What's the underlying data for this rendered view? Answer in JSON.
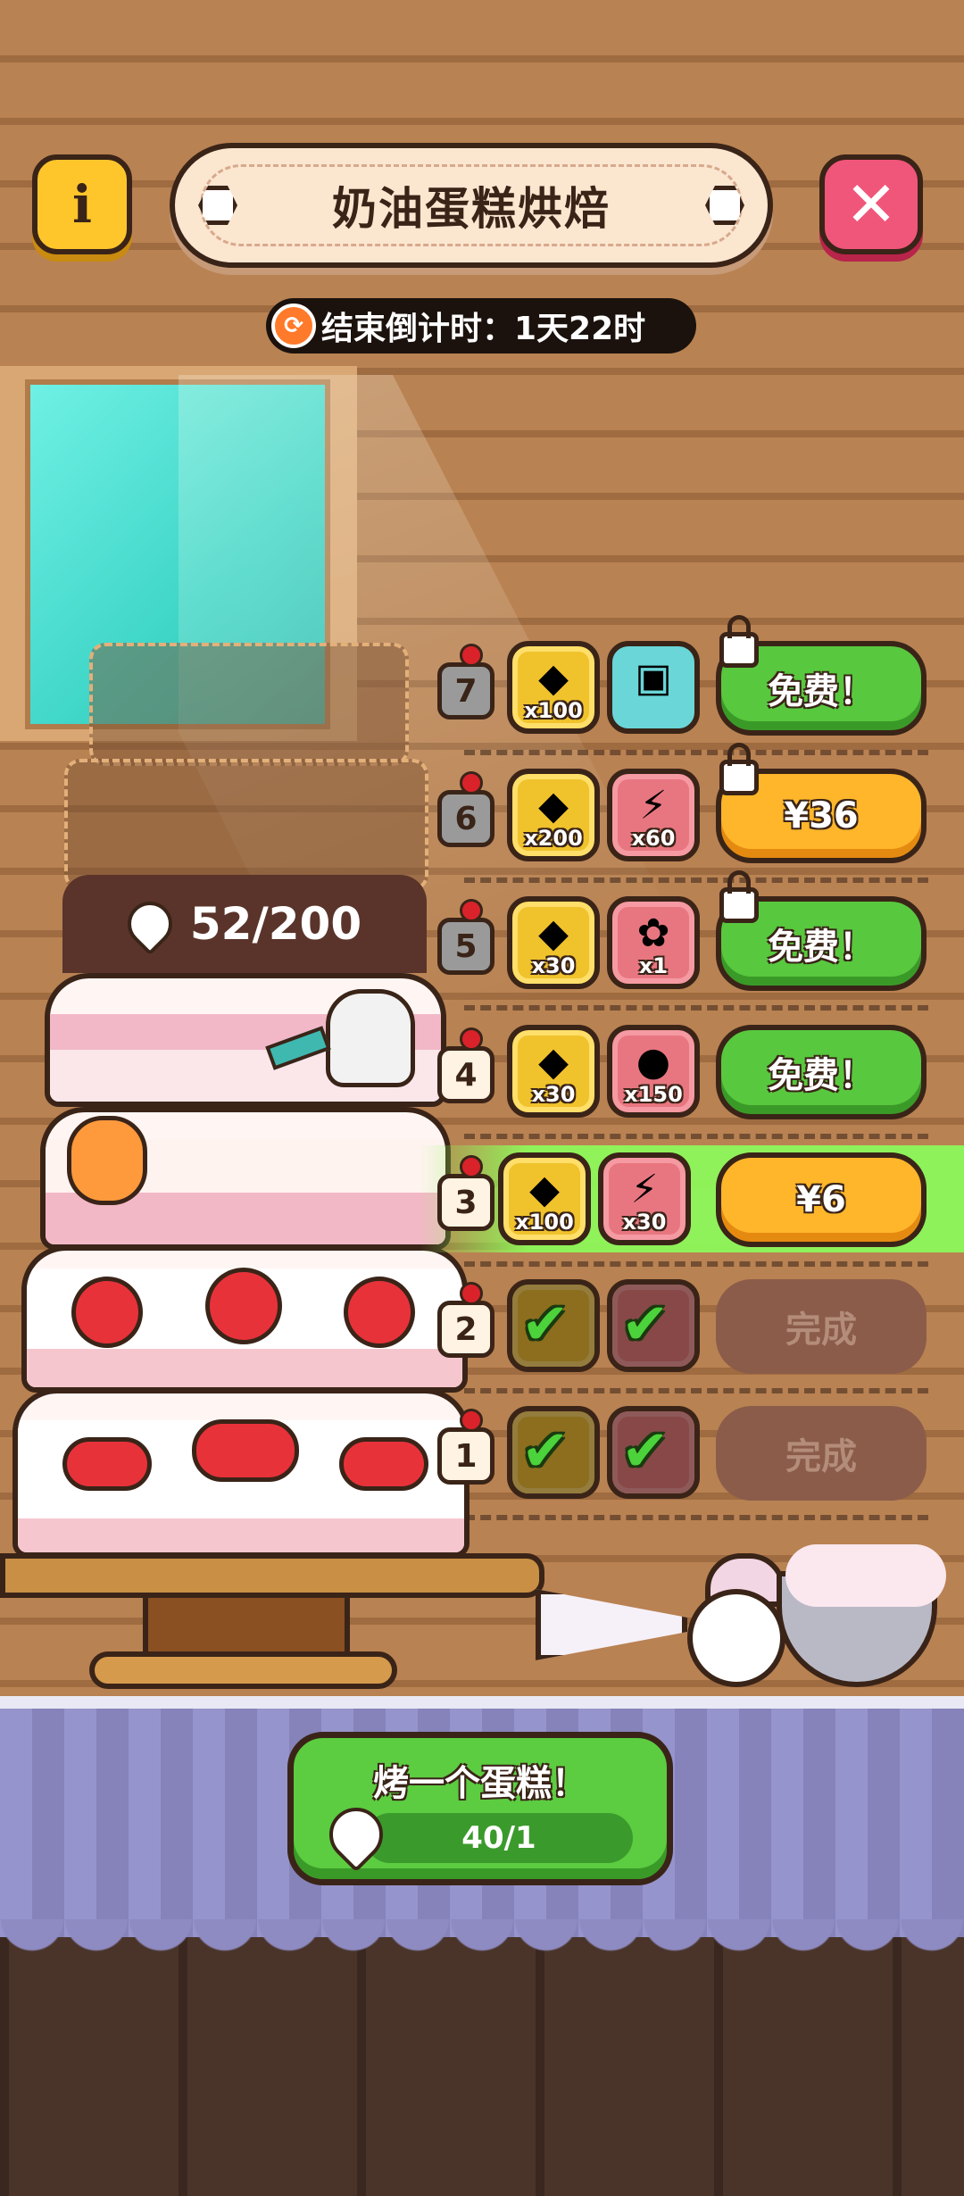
{
  "header": {
    "title": "奶油蛋糕烘焙",
    "info_icon": "info-icon",
    "close_icon": "close-icon",
    "countdown_label": "结束倒计时：1天22时"
  },
  "cake_progress": {
    "current_text": "52/200",
    "current": 52,
    "total": 200
  },
  "reward_tiers": [
    {
      "level": "7",
      "reward1_qty": "x100",
      "reward1_icon": "crystal-icon",
      "reward2_qty": "",
      "reward2_icon": "robot-card-icon",
      "button": "免费！",
      "button_style": "green",
      "locked": true
    },
    {
      "level": "6",
      "reward1_qty": "x200",
      "reward1_icon": "crystal-icon",
      "reward2_qty": "x60",
      "reward2_icon": "lightning-icon",
      "button": "¥36",
      "button_style": "orange",
      "locked": true
    },
    {
      "level": "5",
      "reward1_qty": "x30",
      "reward1_icon": "crystal-icon",
      "reward2_qty": "x1",
      "reward2_icon": "seed-packet-icon",
      "button": "免费！",
      "button_style": "green",
      "locked": true
    },
    {
      "level": "4",
      "reward1_qty": "x30",
      "reward1_icon": "crystal-icon",
      "reward2_qty": "x150",
      "reward2_icon": "cookie-icon",
      "button": "免费！",
      "button_style": "green",
      "locked": false
    },
    {
      "level": "3",
      "reward1_qty": "x100",
      "reward1_icon": "crystal-icon",
      "reward2_qty": "x30",
      "reward2_icon": "lightning-icon",
      "button": "¥6",
      "button_style": "orange",
      "locked": false,
      "current": true
    },
    {
      "level": "2",
      "reward1_qty": "",
      "reward1_icon": "check-icon",
      "reward2_qty": "",
      "reward2_icon": "check-icon",
      "button": "完成",
      "button_style": "done",
      "locked": false
    },
    {
      "level": "1",
      "reward1_qty": "",
      "reward1_icon": "check-icon",
      "reward2_qty": "",
      "reward2_icon": "check-icon",
      "button": "完成",
      "button_style": "done",
      "locked": false
    }
  ],
  "bake_button": {
    "label": "烤一个蛋糕！",
    "count_text": "40/1"
  },
  "colors": {
    "accent_green": "#58c83e",
    "accent_orange": "#ffb62a",
    "close_pink": "#f0567a",
    "info_yellow": "#ffc62b",
    "highlight_row": "#8ef25a"
  }
}
